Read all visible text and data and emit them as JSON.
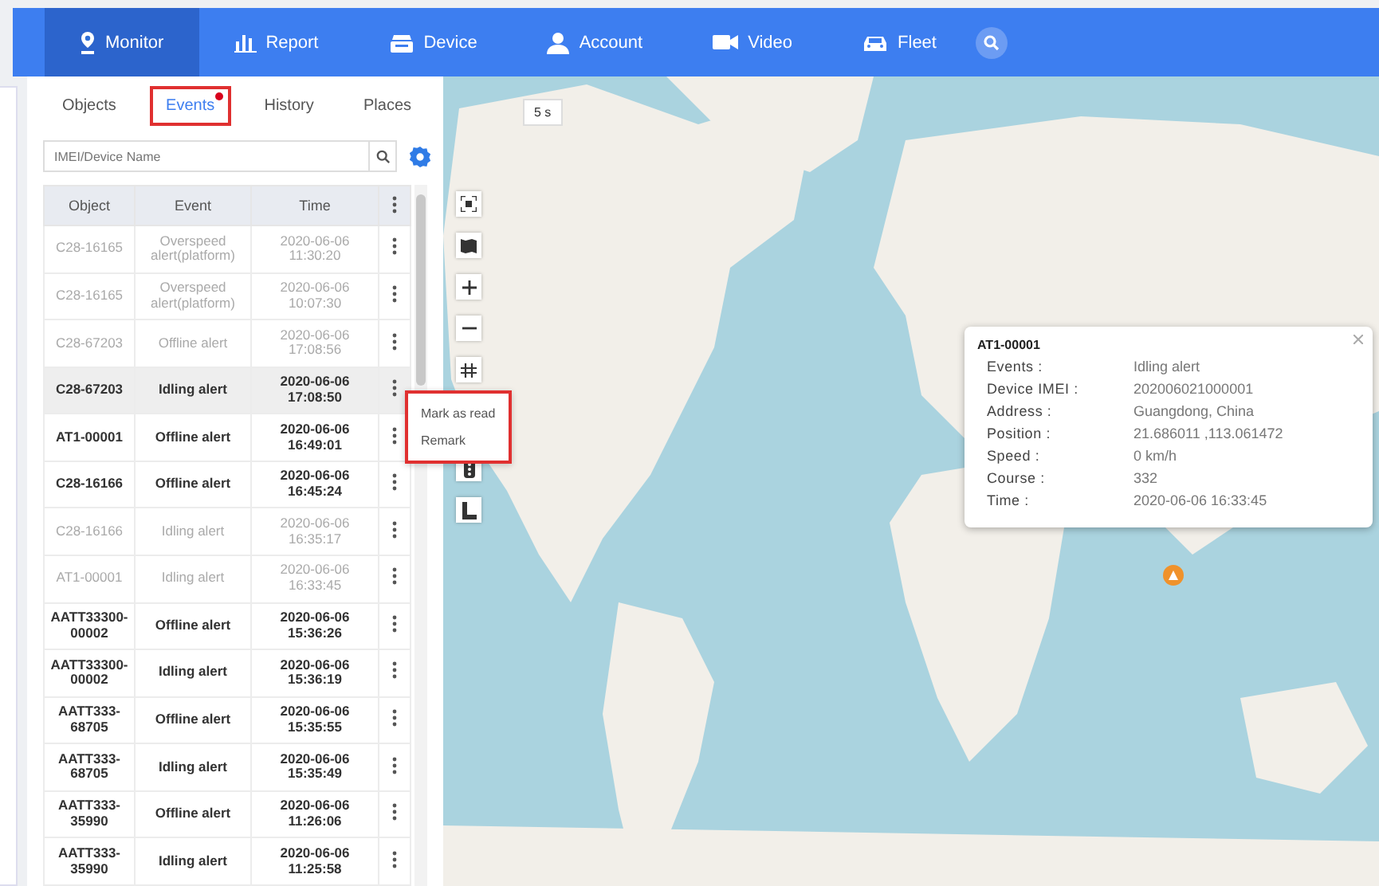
{
  "nav": [
    {
      "label": "Monitor",
      "selected": true
    },
    {
      "label": "Report",
      "selected": false
    },
    {
      "label": "Device",
      "selected": false
    },
    {
      "label": "Account",
      "selected": false
    },
    {
      "label": "Video",
      "selected": false
    },
    {
      "label": "Fleet",
      "selected": false
    }
  ],
  "tabs": [
    {
      "label": "Objects",
      "selected": false,
      "outlined": false,
      "badge": false
    },
    {
      "label": "Events",
      "selected": true,
      "outlined": true,
      "badge": true
    },
    {
      "label": "History",
      "selected": false,
      "outlined": false,
      "badge": false
    },
    {
      "label": "Places",
      "selected": false,
      "outlined": false,
      "badge": false
    }
  ],
  "search": {
    "placeholder": "IMEI/Device Name"
  },
  "table": {
    "columns": [
      "Object",
      "Event",
      "Time"
    ],
    "rows": [
      {
        "object": "C28-16165",
        "event": "Overspeed alert(platform)",
        "time": "2020-06-06 11:30:20",
        "read": true,
        "selected": false
      },
      {
        "object": "C28-16165",
        "event": "Overspeed alert(platform)",
        "time": "2020-06-06 10:07:30",
        "read": true,
        "selected": false
      },
      {
        "object": "C28-67203",
        "event": "Offline alert",
        "time": "2020-06-06 17:08:56",
        "read": true,
        "selected": false
      },
      {
        "object": "C28-67203",
        "event": "Idling alert",
        "time": "2020-06-06 17:08:50",
        "read": false,
        "selected": true
      },
      {
        "object": "AT1-00001",
        "event": "Offline alert",
        "time": "2020-06-06 16:49:01",
        "read": false,
        "selected": false
      },
      {
        "object": "C28-16166",
        "event": "Offline alert",
        "time": "2020-06-06 16:45:24",
        "read": false,
        "selected": false
      },
      {
        "object": "C28-16166",
        "event": "Idling alert",
        "time": "2020-06-06 16:35:17",
        "read": true,
        "selected": false
      },
      {
        "object": "AT1-00001",
        "event": "Idling alert",
        "time": "2020-06-06 16:33:45",
        "read": true,
        "selected": false
      },
      {
        "object": "AATT33300-00002",
        "event": "Offline alert",
        "time": "2020-06-06 15:36:26",
        "read": false,
        "selected": false
      },
      {
        "object": "AATT33300-00002",
        "event": "Idling alert",
        "time": "2020-06-06 15:36:19",
        "read": false,
        "selected": false
      },
      {
        "object": "AATT333-68705",
        "event": "Offline alert",
        "time": "2020-06-06 15:35:55",
        "read": false,
        "selected": false
      },
      {
        "object": "AATT333-68705",
        "event": "Idling alert",
        "time": "2020-06-06 15:35:49",
        "read": false,
        "selected": false
      },
      {
        "object": "AATT333-35990",
        "event": "Offline alert",
        "time": "2020-06-06 11:26:06",
        "read": false,
        "selected": false
      },
      {
        "object": "AATT333-35990",
        "event": "Idling alert",
        "time": "2020-06-06 11:25:58",
        "read": false,
        "selected": false
      }
    ]
  },
  "context_menu": {
    "outlined": true,
    "items": [
      "Mark as read",
      "Remark"
    ]
  },
  "map": {
    "refresh": "5 s",
    "popup": {
      "title": "AT1-00001",
      "fields": [
        {
          "label": "Events :",
          "value": "Idling alert"
        },
        {
          "label": "Device IMEI :",
          "value": "202006021000001"
        },
        {
          "label": "Address :",
          "value": "Guangdong, China"
        },
        {
          "label": "Position :",
          "value": "21.686011 ,113.061472"
        },
        {
          "label": "Speed :",
          "value": "0 km/h"
        },
        {
          "label": "Course :",
          "value": "332"
        },
        {
          "label": "Time :",
          "value": "2020-06-06 16:33:45"
        }
      ]
    }
  }
}
